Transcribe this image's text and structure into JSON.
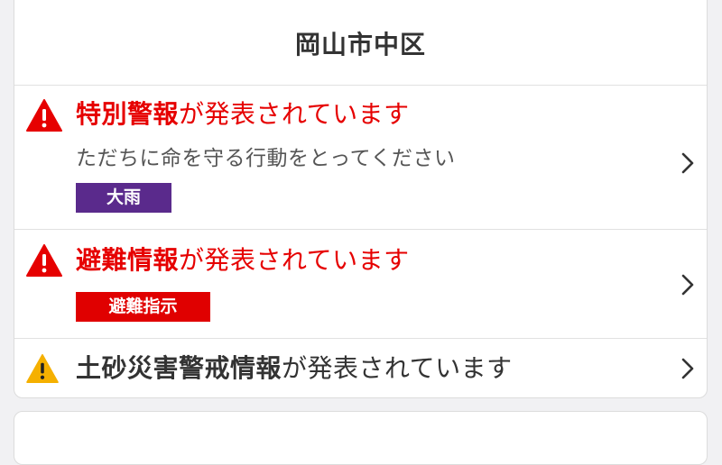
{
  "location": {
    "name": "岡山市中区"
  },
  "alerts": [
    {
      "title_emphasis": "特別警報",
      "title_rest": "が発表されています",
      "description": "ただちに命を守る行動をとってください",
      "tag": "大雨",
      "icon": "warning-triangle-red-icon",
      "tag_color": "#5a2a8c"
    },
    {
      "title_emphasis": "避難情報",
      "title_rest": "が発表されています",
      "tag": "避難指示",
      "icon": "warning-triangle-red-icon",
      "tag_color": "#e00000"
    },
    {
      "title_emphasis": "土砂災害警戒情報",
      "title_rest": "が発表されています",
      "icon": "warning-triangle-yellow-icon"
    }
  ],
  "colors": {
    "alert_red": "#e60000",
    "warning_yellow": "#f5b000",
    "heavy_rain_purple": "#5a2a8c",
    "text_dark": "#333333",
    "chevron": "#333333"
  }
}
